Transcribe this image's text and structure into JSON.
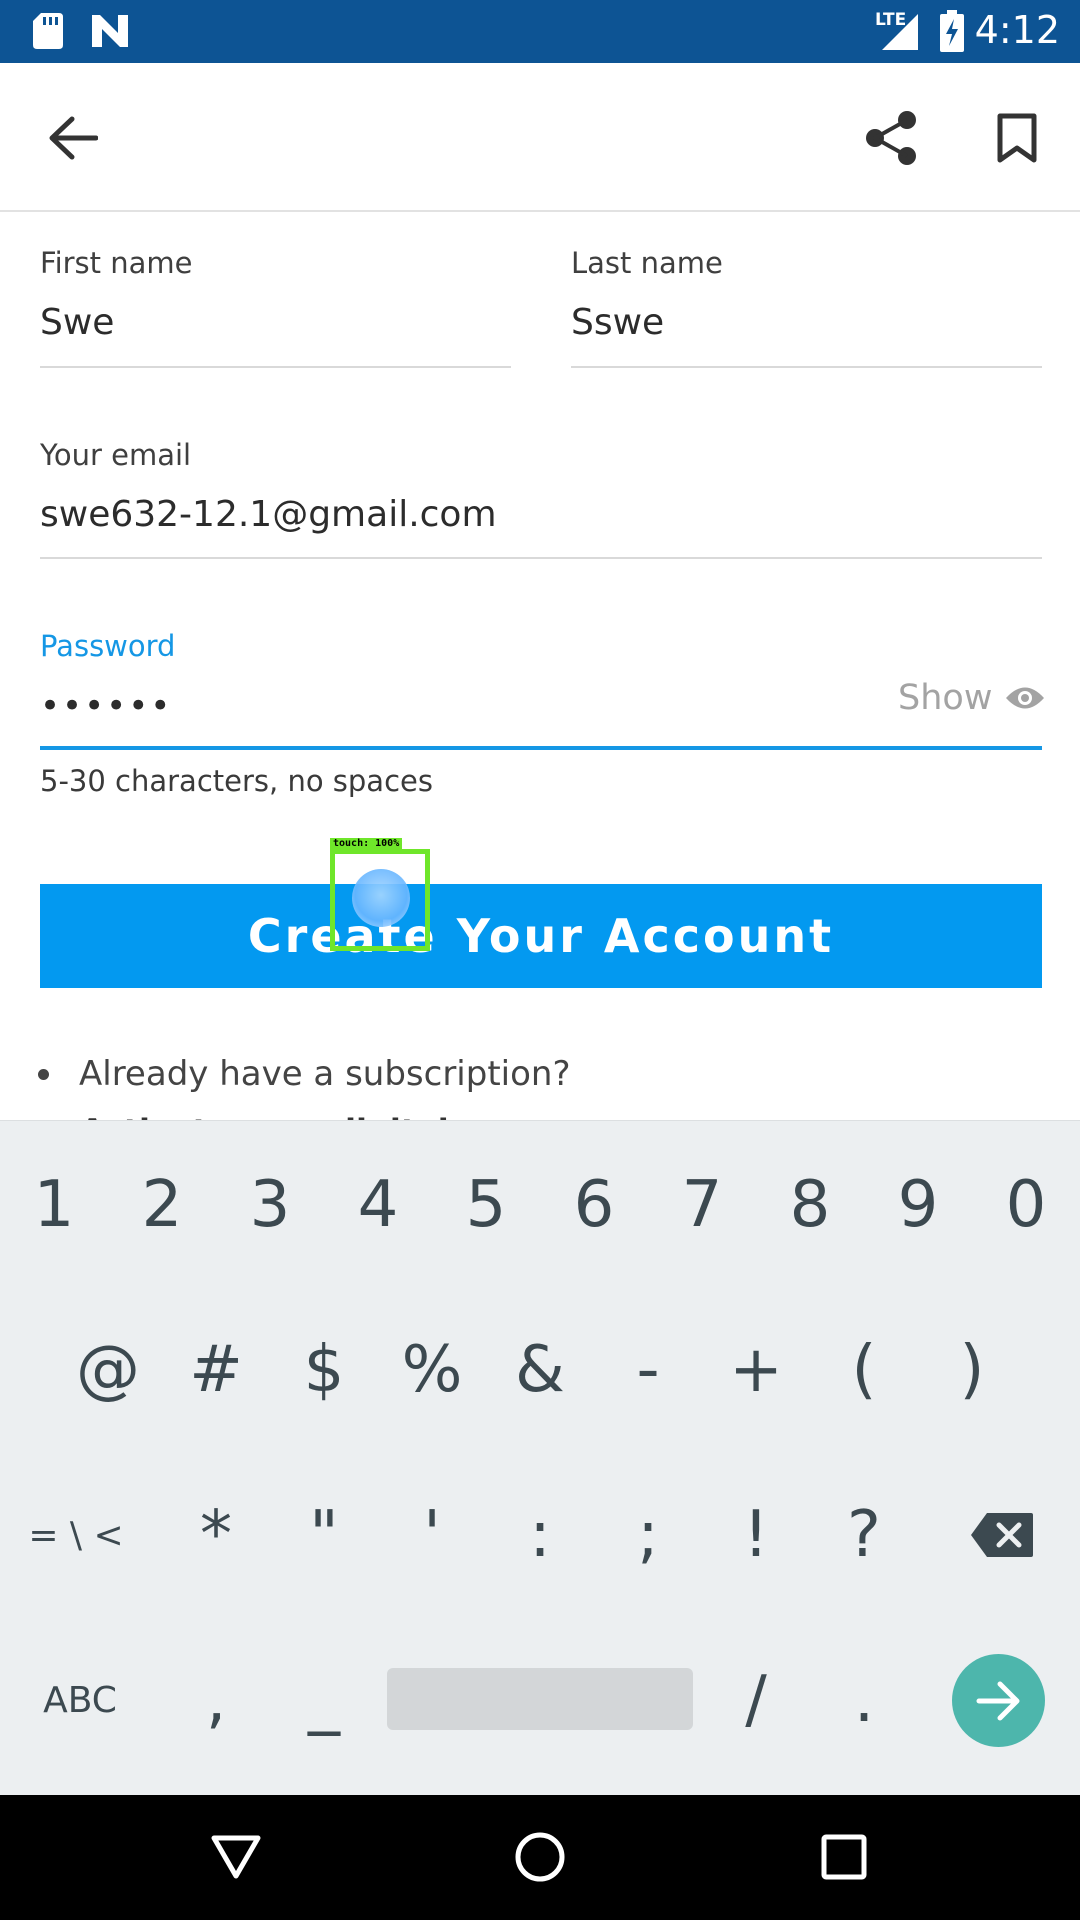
{
  "status_bar": {
    "time": "4:12",
    "network": "LTE",
    "icons": [
      "sd-card-icon",
      "n-app-icon",
      "signal-icon",
      "battery-charging-icon"
    ]
  },
  "app_bar": {
    "icons": [
      "back-arrow-icon",
      "share-icon",
      "bookmark-icon"
    ]
  },
  "form": {
    "first_name": {
      "label": "First name",
      "value": "Swe"
    },
    "last_name": {
      "label": "Last name",
      "value": "Sswe"
    },
    "email": {
      "label": "Your email",
      "value": "swe632-12.1@gmail.com"
    },
    "password": {
      "label": "Password",
      "value": "••••••",
      "show_label": "Show",
      "helper": "5-30 characters, no spaces",
      "accent_color": "#1597e5"
    },
    "submit_label": "Create Your Account",
    "submit_color": "#0399f0",
    "subscription_text": "Already have a subscription?",
    "partial_link_text": "Activate your digital access"
  },
  "touch_overlay": {
    "label": "touch: 100%"
  },
  "keyboard": {
    "row1": [
      "1",
      "2",
      "3",
      "4",
      "5",
      "6",
      "7",
      "8",
      "9",
      "0"
    ],
    "row2": [
      "@",
      "#",
      "$",
      "%",
      "&",
      "-",
      "+",
      "(",
      ")"
    ],
    "row3": [
      "= \\ <",
      "*",
      "\"",
      "'",
      ":",
      ";",
      "!",
      "?"
    ],
    "row4": {
      "abc": "ABC",
      "comma": ",",
      "underscore": "_",
      "slash": "/",
      "period": "."
    },
    "go_color": "#4db6ac"
  },
  "nav_bar": {
    "icons": [
      "back-triangle-icon",
      "home-circle-icon",
      "recents-square-icon"
    ]
  }
}
